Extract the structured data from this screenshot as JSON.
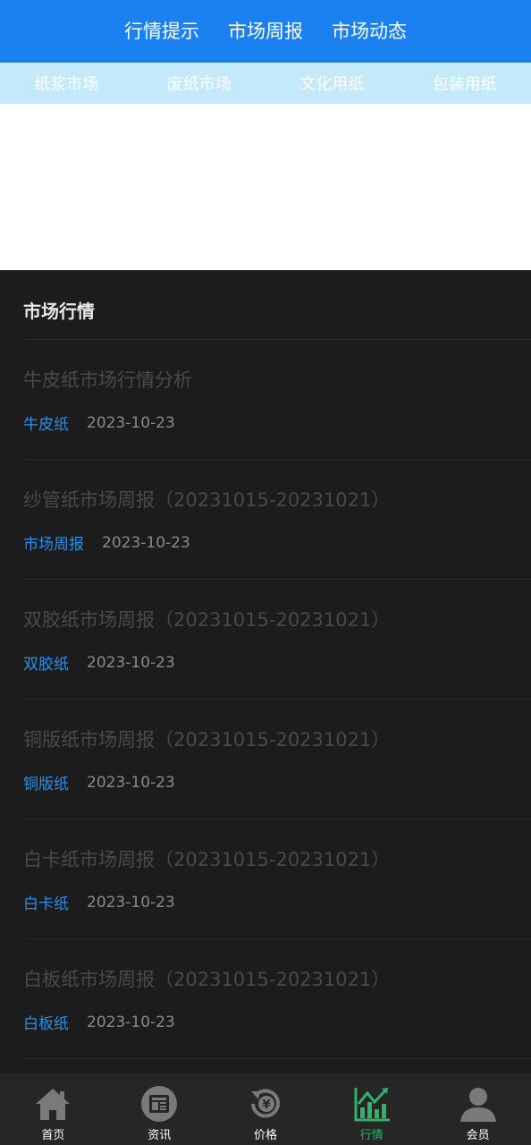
{
  "top_tabs": [
    "行情提示",
    "市场周报",
    "市场动态"
  ],
  "sub_tabs": [
    "纸浆市场",
    "废纸市场",
    "文化用纸",
    "包装用纸"
  ],
  "section": {
    "title": "市场行情"
  },
  "articles": [
    {
      "title": "牛皮纸市场行情分析",
      "tag": "牛皮纸",
      "date": "2023-10-23"
    },
    {
      "title": "纱管纸市场周报（20231015-20231021）",
      "tag": "市场周报",
      "date": "2023-10-23"
    },
    {
      "title": "双胶纸市场周报（20231015-20231021）",
      "tag": "双胶纸",
      "date": "2023-10-23"
    },
    {
      "title": "铜版纸市场周报（20231015-20231021）",
      "tag": "铜版纸",
      "date": "2023-10-23"
    },
    {
      "title": "白卡纸市场周报（20231015-20231021）",
      "tag": "白卡纸",
      "date": "2023-10-23"
    },
    {
      "title": "白板纸市场周报（20231015-20231021）",
      "tag": "白板纸",
      "date": "2023-10-23"
    }
  ],
  "bottom_nav": [
    {
      "label": "首页",
      "icon": "home-icon"
    },
    {
      "label": "资讯",
      "icon": "news-icon"
    },
    {
      "label": "价格",
      "icon": "price-icon"
    },
    {
      "label": "行情",
      "icon": "chart-icon",
      "active": true
    },
    {
      "label": "会员",
      "icon": "user-icon"
    }
  ],
  "colors": {
    "primary_blue": "#1b80f0",
    "sub_tab_bg": "#c3e9fa",
    "tag_blue": "#2a8fe8",
    "active_green": "#2fb36a",
    "dark_bg": "#1c1c1c"
  }
}
